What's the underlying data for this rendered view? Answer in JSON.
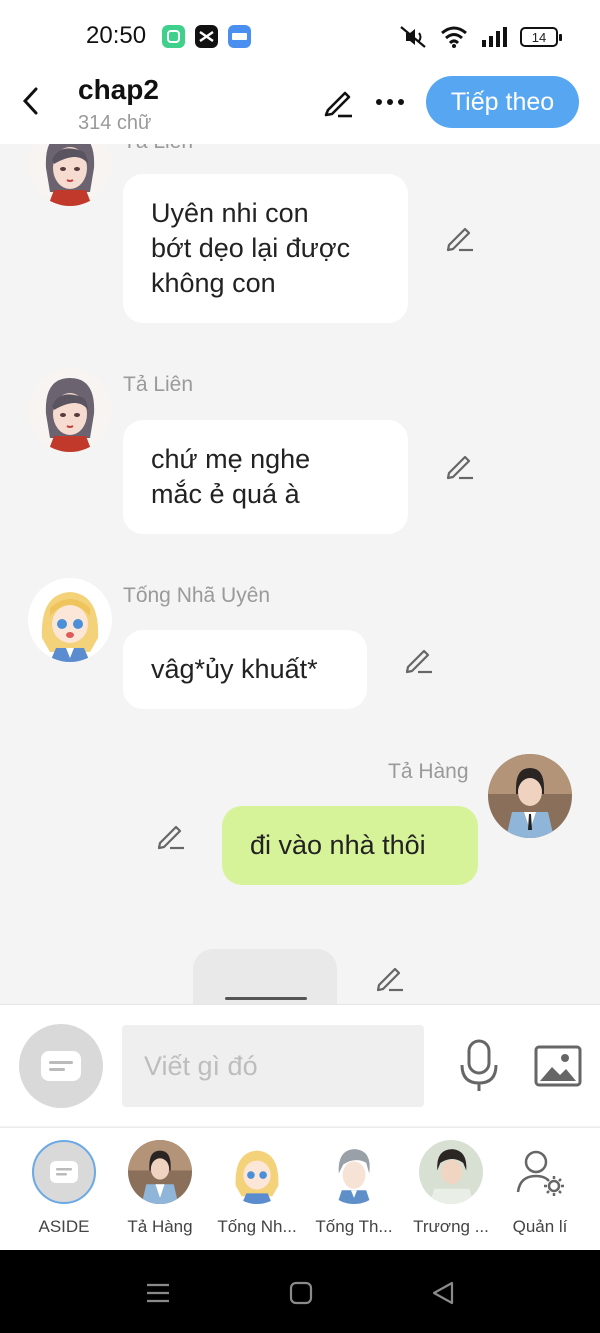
{
  "status_bar": {
    "time": "20:50",
    "battery": "14",
    "icons": [
      "app-green-icon",
      "capcut-icon",
      "noveltoon-icon",
      "mute-icon",
      "wifi-icon",
      "signal-icon",
      "battery-icon"
    ]
  },
  "header": {
    "title": "chap2",
    "word_count": "314 chữ",
    "next_button": "Tiếp theo"
  },
  "messages": [
    {
      "sender": "Tả Liên",
      "text_lines": [
        "Uyên nhi con",
        "bớt dẹo lại được",
        "không con"
      ]
    },
    {
      "sender": "Tả Liên",
      "text_lines": [
        "chứ mẹ nghe",
        "mắc ẻ quá à"
      ]
    },
    {
      "sender": "Tống Nhã Uyên",
      "text_lines": [
        "vâg*ủy khuất*"
      ]
    },
    {
      "sender": "Tả Hàng",
      "text_lines": [
        "đi vào nhà thôi"
      ],
      "is_me": true
    }
  ],
  "input": {
    "placeholder": "Viết gì đó"
  },
  "characters": [
    {
      "label": "ASIDE"
    },
    {
      "label": "Tả Hàng"
    },
    {
      "label": "Tống Nh..."
    },
    {
      "label": "Tống Th..."
    },
    {
      "label": "Trương ..."
    },
    {
      "label": "Quản lí"
    }
  ],
  "colors": {
    "accent": "#56a6f2",
    "my_bubble": "#d7f39a",
    "background": "#f4f4f4"
  }
}
